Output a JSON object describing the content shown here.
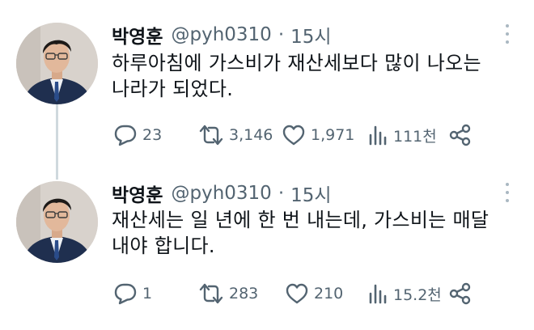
{
  "colors": {
    "text": "#0f1419",
    "secondary": "#536471",
    "thread_line": "#cfd9de",
    "more_dots": "#aab8c2"
  },
  "tweets": [
    {
      "author": {
        "name": "박영훈",
        "handle": "@pyh0310",
        "separator": "·",
        "time": "15시"
      },
      "text_lines": [
        "하루아침에 가스비가 재산세보다 많이 나오는",
        "나라가 되었다."
      ],
      "stats": {
        "replies": "23",
        "retweets": "3,146",
        "likes": "1,971",
        "views": "111천"
      }
    },
    {
      "author": {
        "name": "박영훈",
        "handle": "@pyh0310",
        "separator": "·",
        "time": "15시"
      },
      "text_lines": [
        "재산세는 일 년에 한 번 내는데, 가스비는 매달",
        "내야 합니다."
      ],
      "stats": {
        "replies": "1",
        "retweets": "283",
        "likes": "210",
        "views": "15.2천"
      }
    }
  ]
}
